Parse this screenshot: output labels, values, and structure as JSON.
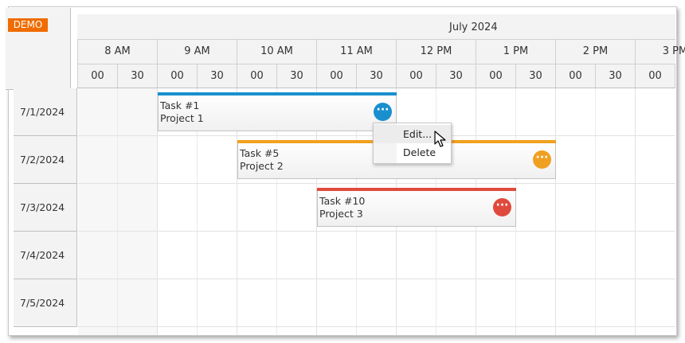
{
  "demo_badge": "DEMO",
  "header": {
    "month": "July 2024",
    "hours": [
      "8 AM",
      "9 AM",
      "10 AM",
      "11 AM",
      "12 PM",
      "1 PM",
      "2 PM",
      "3 PM"
    ],
    "minutes": [
      "00",
      "30",
      "00",
      "30",
      "00",
      "30",
      "00",
      "30",
      "00",
      "30",
      "00",
      "30",
      "00",
      "30",
      "00",
      "30"
    ]
  },
  "rows": [
    {
      "label": "7/1/2024"
    },
    {
      "label": "7/2/2024"
    },
    {
      "label": "7/3/2024"
    },
    {
      "label": "7/4/2024"
    },
    {
      "label": "7/5/2024"
    }
  ],
  "events": [
    {
      "text": "Task #1",
      "project": "Project 1",
      "color": "#1a8fce",
      "button_icon": "more-dots-icon"
    },
    {
      "text": "Task #5",
      "project": "Project 2",
      "color": "#f0a020",
      "button_icon": "more-dots-icon"
    },
    {
      "text": "Task #10",
      "project": "Project 3",
      "color": "#e04a3c",
      "button_icon": "more-dots-icon"
    }
  ],
  "context_menu": {
    "items": [
      {
        "label": "Edit..."
      },
      {
        "label": "Delete"
      }
    ]
  }
}
